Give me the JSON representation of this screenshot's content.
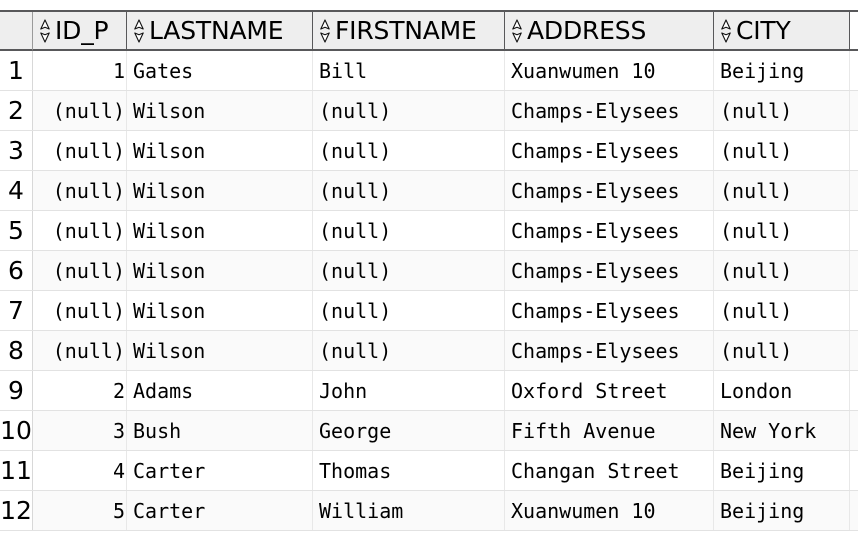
{
  "grid": {
    "row_number_header": "",
    "sort_icon_name": "sort-updown-icon",
    "columns": [
      {
        "key": "id_p",
        "label": "ID_P",
        "align": "num"
      },
      {
        "key": "lastname",
        "label": "LASTNAME",
        "align": "txt"
      },
      {
        "key": "firstname",
        "label": "FIRSTNAME",
        "align": "txt"
      },
      {
        "key": "address",
        "label": "ADDRESS",
        "align": "txt"
      },
      {
        "key": "city",
        "label": "CITY",
        "align": "txt"
      }
    ],
    "rows": [
      {
        "n": "1",
        "id_p": "1",
        "lastname": "Gates",
        "firstname": "Bill",
        "address": "Xuanwumen 10",
        "city": "Beijing"
      },
      {
        "n": "2",
        "id_p": "(null)",
        "lastname": "Wilson",
        "firstname": "(null)",
        "address": "Champs-Elysees",
        "city": "(null)"
      },
      {
        "n": "3",
        "id_p": "(null)",
        "lastname": "Wilson",
        "firstname": "(null)",
        "address": "Champs-Elysees",
        "city": "(null)"
      },
      {
        "n": "4",
        "id_p": "(null)",
        "lastname": "Wilson",
        "firstname": "(null)",
        "address": "Champs-Elysees",
        "city": "(null)"
      },
      {
        "n": "5",
        "id_p": "(null)",
        "lastname": "Wilson",
        "firstname": "(null)",
        "address": "Champs-Elysees",
        "city": "(null)"
      },
      {
        "n": "6",
        "id_p": "(null)",
        "lastname": "Wilson",
        "firstname": "(null)",
        "address": "Champs-Elysees",
        "city": "(null)"
      },
      {
        "n": "7",
        "id_p": "(null)",
        "lastname": "Wilson",
        "firstname": "(null)",
        "address": "Champs-Elysees",
        "city": "(null)"
      },
      {
        "n": "8",
        "id_p": "(null)",
        "lastname": "Wilson",
        "firstname": "(null)",
        "address": "Champs-Elysees",
        "city": "(null)"
      },
      {
        "n": "9",
        "id_p": "2",
        "lastname": "Adams",
        "firstname": "John",
        "address": "Oxford Street",
        "city": "London"
      },
      {
        "n": "10",
        "id_p": "3",
        "lastname": "Bush",
        "firstname": "George",
        "address": "Fifth Avenue",
        "city": "New York"
      },
      {
        "n": "11",
        "id_p": "4",
        "lastname": "Carter",
        "firstname": "Thomas",
        "address": "Changan Street",
        "city": "Beijing"
      },
      {
        "n": "12",
        "id_p": "5",
        "lastname": "Carter",
        "firstname": "William",
        "address": "Xuanwumen 10",
        "city": "Beijing"
      }
    ]
  },
  "colors": {
    "header_background": "#eeeeee",
    "header_border": "#58585a",
    "row_border": "#e2e2e2",
    "row_alt_background": "#fafafa",
    "text": "#000000"
  }
}
